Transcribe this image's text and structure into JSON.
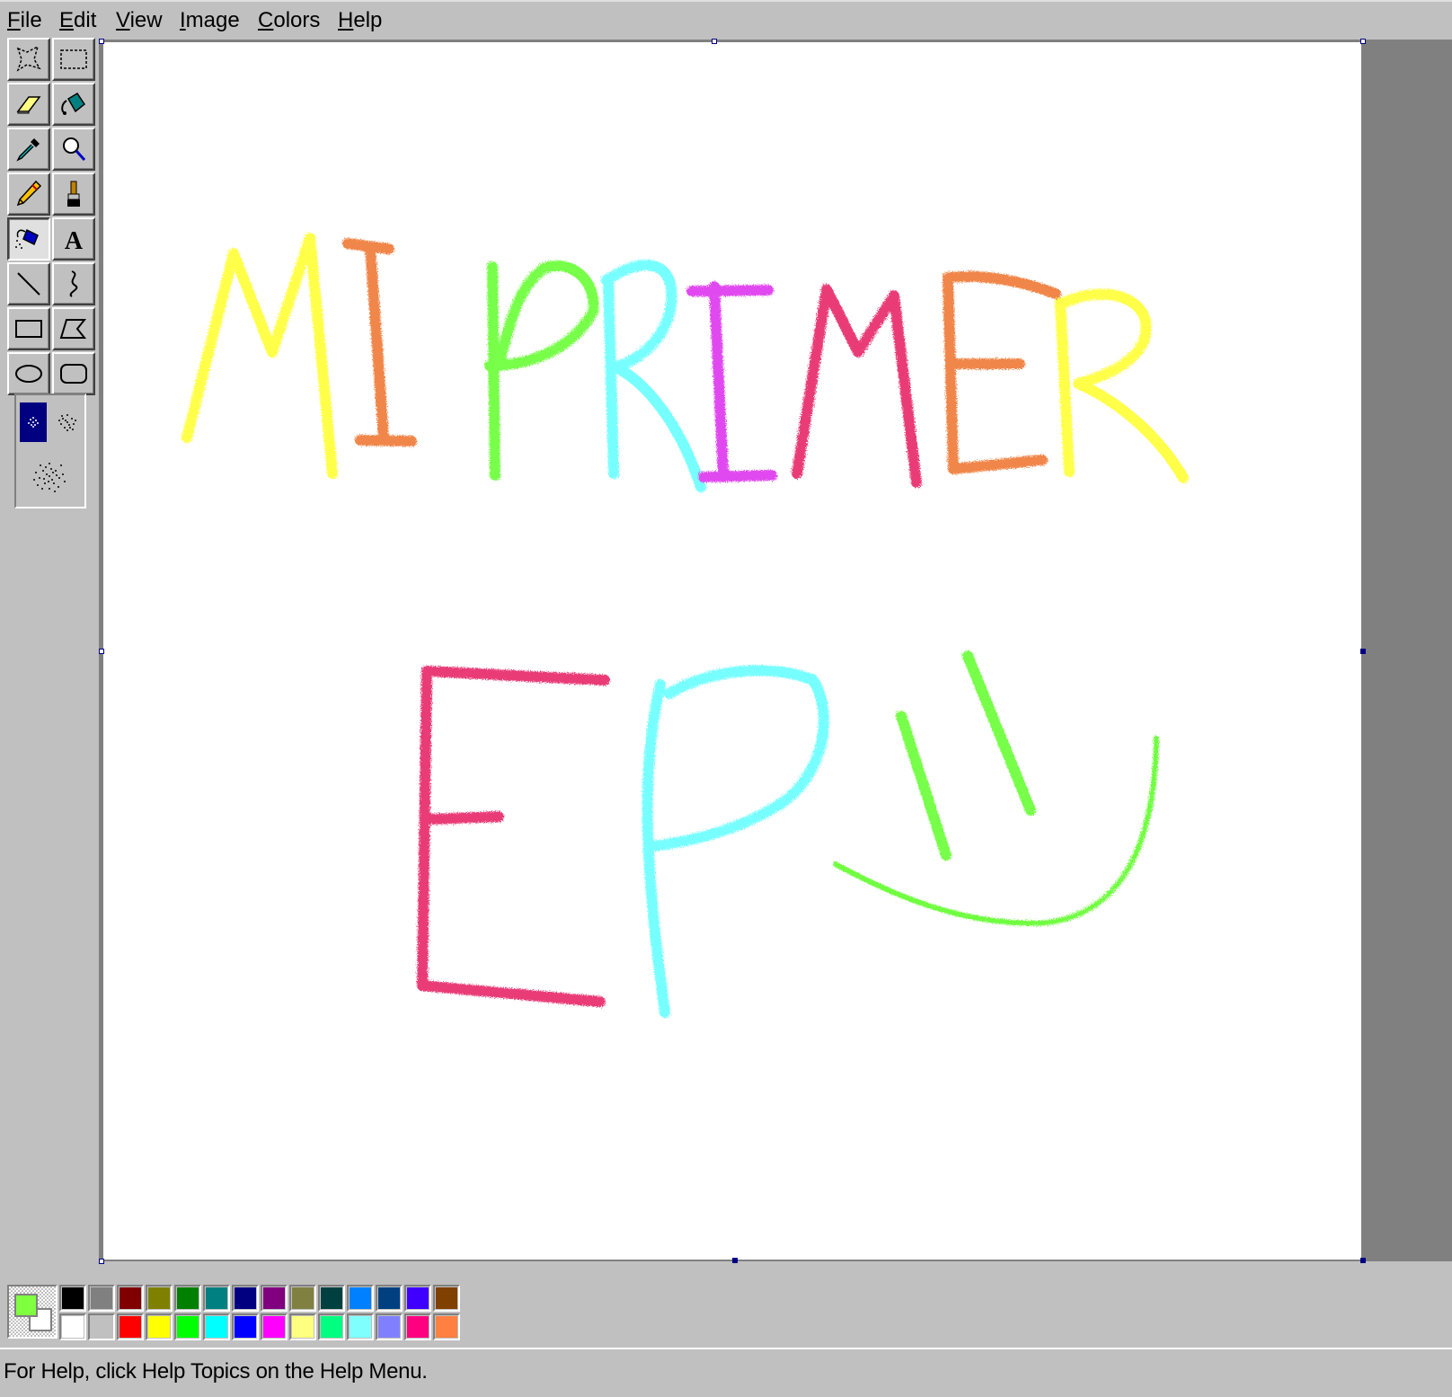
{
  "menu": {
    "file": {
      "acc": "F",
      "rest": "ile"
    },
    "edit": {
      "acc": "E",
      "rest": "dit"
    },
    "view": {
      "acc": "V",
      "rest": "iew"
    },
    "image": {
      "acc": "I",
      "rest": "mage"
    },
    "colors": {
      "acc": "C",
      "rest": "olors"
    },
    "help": {
      "acc": "H",
      "rest": "elp"
    }
  },
  "tools": [
    {
      "name": "free-form-select-icon"
    },
    {
      "name": "select-icon"
    },
    {
      "name": "eraser-icon"
    },
    {
      "name": "fill-with-color-icon"
    },
    {
      "name": "pick-color-icon"
    },
    {
      "name": "magnifier-icon"
    },
    {
      "name": "pencil-icon"
    },
    {
      "name": "brush-icon"
    },
    {
      "name": "airbrush-icon",
      "selected": true
    },
    {
      "name": "text-icon",
      "glyph": "A"
    },
    {
      "name": "line-icon"
    },
    {
      "name": "curve-icon"
    },
    {
      "name": "rectangle-icon"
    },
    {
      "name": "polygon-icon"
    },
    {
      "name": "ellipse-icon"
    },
    {
      "name": "rounded-rectangle-icon"
    }
  ],
  "colors": {
    "foreground": "#80ff40",
    "background": "#ffffff",
    "palette_top": [
      "#000000",
      "#808080",
      "#800000",
      "#808000",
      "#008000",
      "#008080",
      "#000080",
      "#800080",
      "#808040",
      "#004040",
      "#0080ff",
      "#004080",
      "#4000ff",
      "#804000"
    ],
    "palette_bottom": [
      "#ffffff",
      "#c0c0c0",
      "#ff0000",
      "#ffff00",
      "#00ff00",
      "#00ffff",
      "#0000ff",
      "#ff00ff",
      "#ffff80",
      "#00ff80",
      "#80ffff",
      "#8080ff",
      "#ff0080",
      "#ff8040"
    ],
    "stroke_yellow": "#ffff40",
    "stroke_orange": "#f08040",
    "stroke_green": "#70ff40",
    "stroke_cyan": "#70ffff",
    "stroke_magenta": "#e040f0",
    "stroke_pink": "#e83070"
  },
  "status": {
    "text": "For Help, click Help Topics on the Help Menu."
  }
}
